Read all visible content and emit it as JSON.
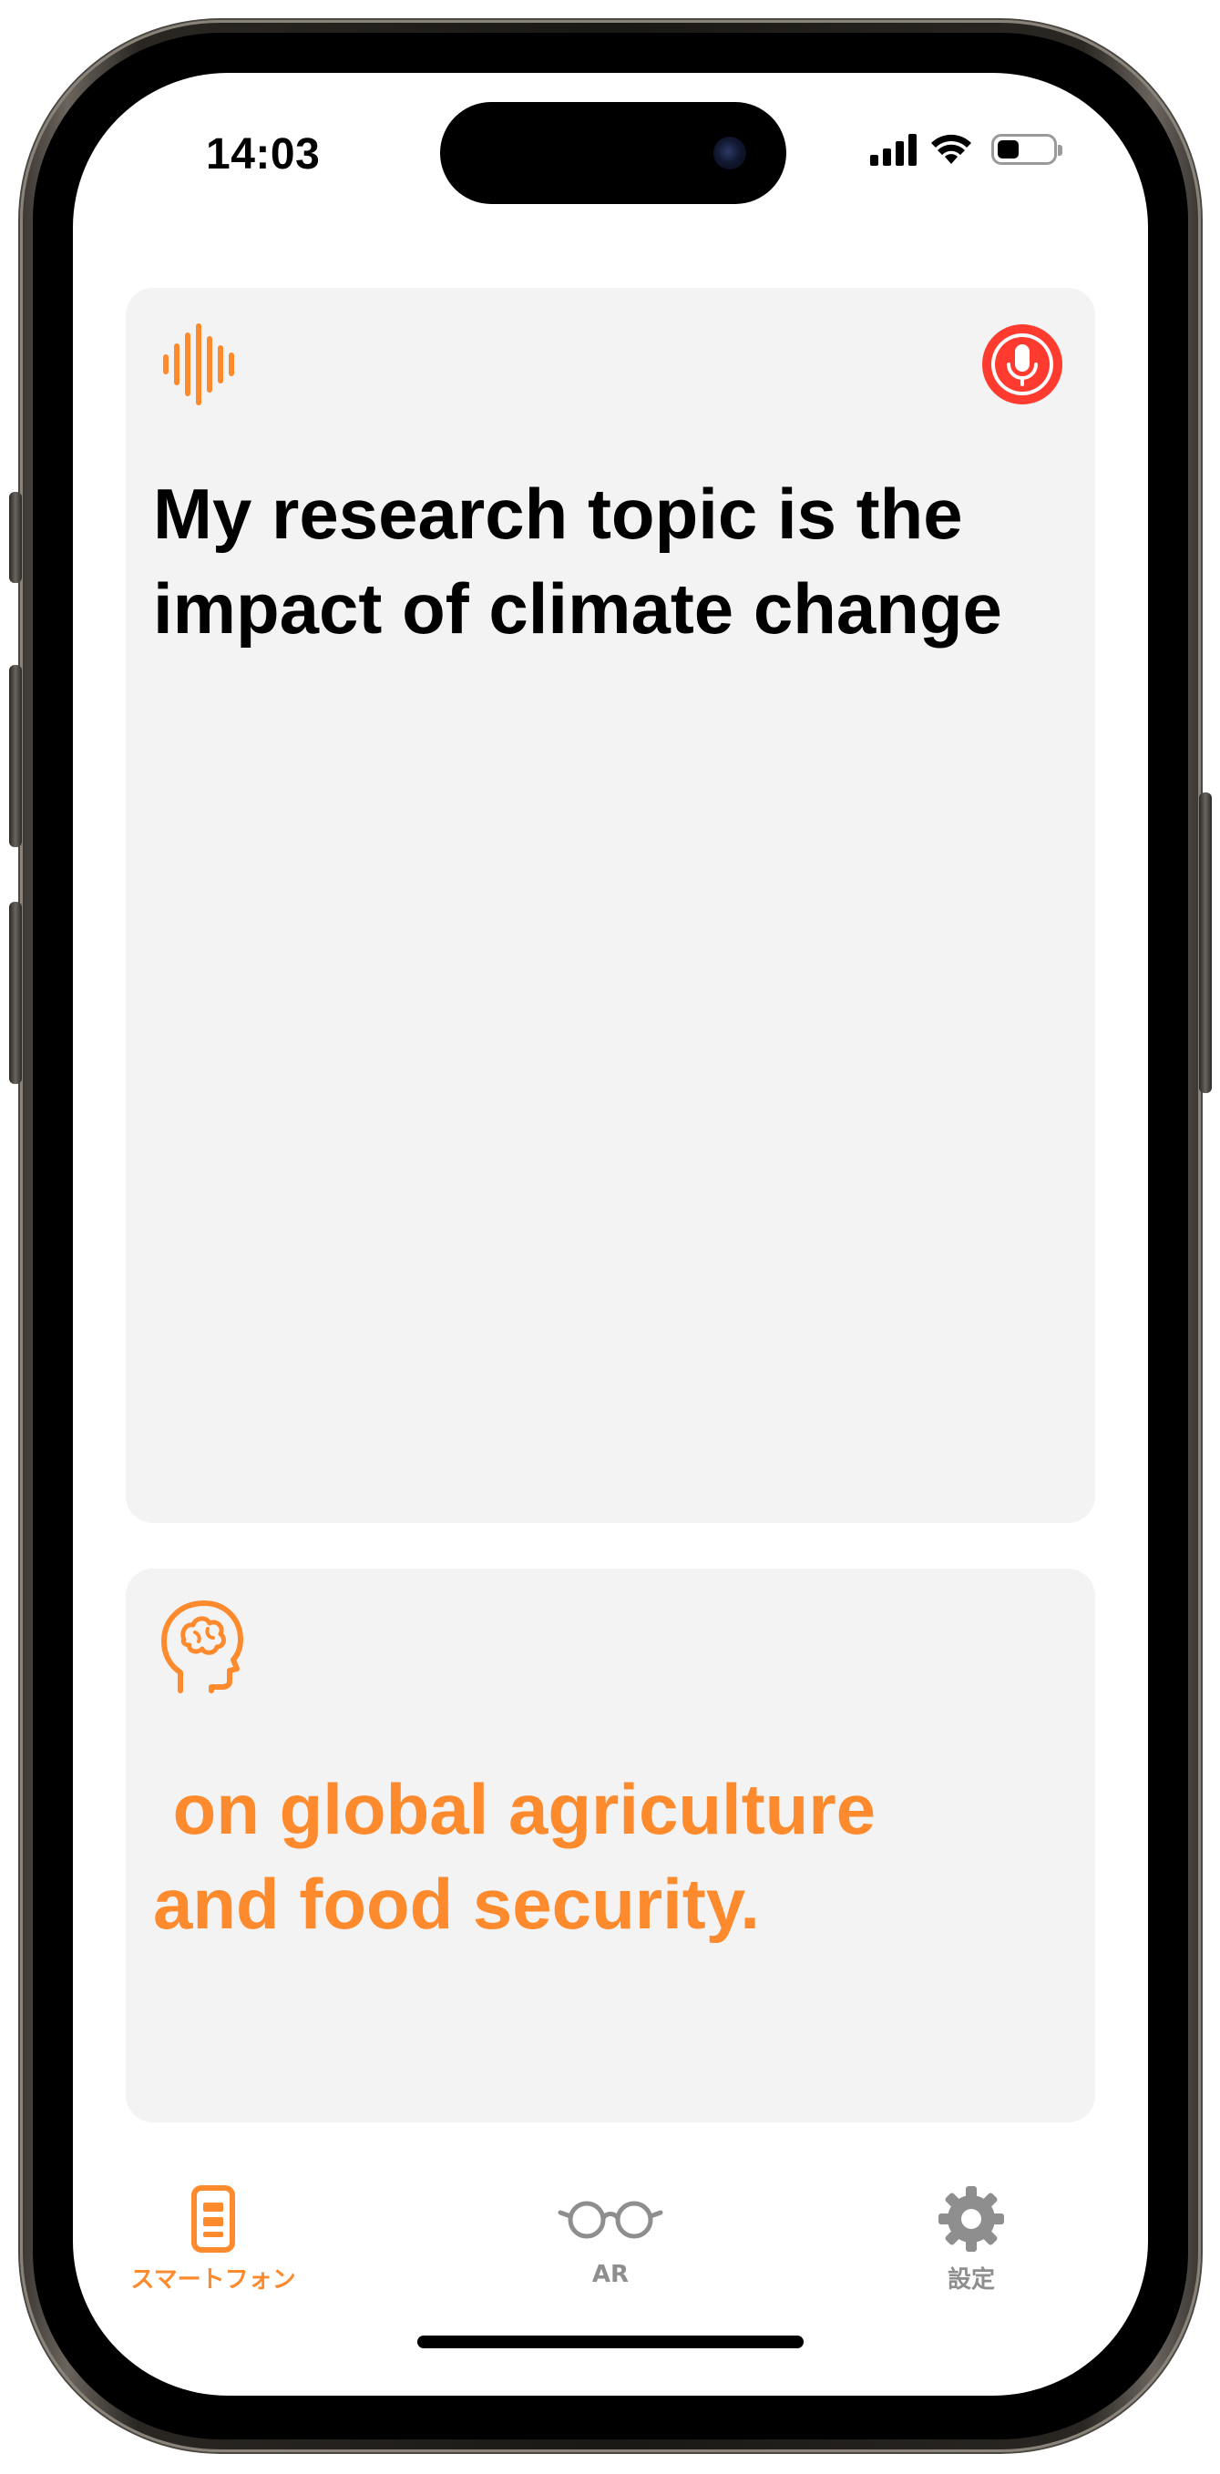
{
  "status_bar": {
    "time": "14:03",
    "battery_level_percent": 40,
    "icons": [
      "cellular-signal-icon",
      "wifi-icon",
      "battery-icon"
    ]
  },
  "transcript_card": {
    "icon": "waveform-icon",
    "mic_icon": "microphone-icon",
    "text": "My research topic is the impact of climate change"
  },
  "suggestion_card": {
    "icon": "brain-head-icon",
    "text": " on global agriculture\nand food security."
  },
  "tab_bar": {
    "tabs": [
      {
        "label": "スマートフォン",
        "icon": "smartphone-icon",
        "active": true
      },
      {
        "label": "AR",
        "icon": "glasses-icon",
        "active": false
      },
      {
        "label": "設定",
        "icon": "gear-icon",
        "active": false
      }
    ]
  },
  "colors": {
    "accent": "#fe8a2e",
    "mic_red": "#ff3b30",
    "card_background": "#f3f3f3",
    "inactive_gray": "#8e8e8e"
  }
}
